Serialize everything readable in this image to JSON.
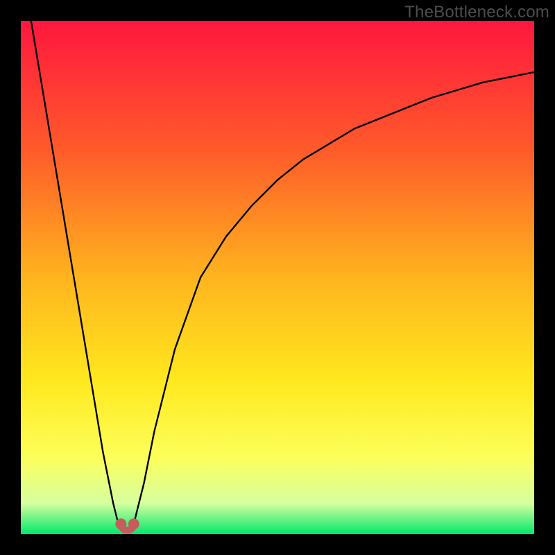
{
  "watermark": "TheBottleneck.com",
  "colors": {
    "frame": "#000000",
    "grad_top": "#ff173e",
    "grad_mid1": "#ff5a2a",
    "grad_mid2": "#ffb41e",
    "grad_mid3": "#ffe81e",
    "grad_mid4": "#fcff5a",
    "grad_mid5": "#d6ffa0",
    "grad_bottom": "#00e86b",
    "curve": "#000000",
    "marker": "#c75c5c"
  },
  "chart_data": {
    "type": "line",
    "title": "",
    "xlabel": "",
    "ylabel": "",
    "xlim": [
      0,
      100
    ],
    "ylim": [
      0,
      100
    ],
    "series": [
      {
        "name": "bottleneck-curve-left",
        "x": [
          2,
          4,
          6,
          8,
          10,
          12,
          14,
          16,
          18,
          19
        ],
        "values": [
          100,
          88,
          76,
          64,
          52,
          40,
          28,
          16,
          6,
          2
        ]
      },
      {
        "name": "bottleneck-curve-right",
        "x": [
          22,
          24,
          26,
          30,
          35,
          40,
          45,
          50,
          55,
          60,
          65,
          70,
          75,
          80,
          85,
          90,
          95,
          100
        ],
        "values": [
          2,
          10,
          20,
          36,
          50,
          58,
          64,
          69,
          73,
          76,
          79,
          81,
          83,
          85,
          86.5,
          88,
          89,
          90
        ]
      }
    ],
    "markers": [
      {
        "name": "min-left",
        "x": 19.5,
        "y": 2
      },
      {
        "name": "min-right",
        "x": 22.0,
        "y": 2
      }
    ],
    "marker_link": {
      "from": 0,
      "to": 1
    }
  }
}
